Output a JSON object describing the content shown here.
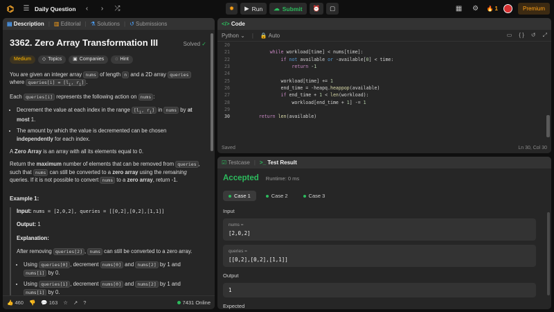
{
  "topbar": {
    "title": "Daily Question",
    "run_label": "Run",
    "submit_label": "Submit",
    "streak": "1",
    "premium_label": "Premium"
  },
  "left": {
    "tabs": [
      "Description",
      "Editorial",
      "Solutions",
      "Submissions"
    ],
    "title": "3362. Zero Array Transformation III",
    "solved": "Solved",
    "tags": [
      "Medium",
      "Topics",
      "Companies",
      "Hint"
    ],
    "footer": {
      "likes": "460",
      "comments": "163",
      "online": "7431 Online"
    }
  },
  "code": {
    "tab": "Code",
    "language": "Python",
    "mode": "Auto",
    "saved": "Saved",
    "cursor": "Ln 30, Col 30"
  },
  "result": {
    "tabs": [
      "Testcase",
      "Test Result"
    ],
    "status": "Accepted",
    "runtime": "Runtime: 0 ms",
    "cases": [
      "Case 1",
      "Case 2",
      "Case 3"
    ],
    "input_label": "Input",
    "var1_name": "nums =",
    "var1_value": "[2,0,2]",
    "var2_name": "queries =",
    "var2_value": "[[0,2],[0,2],[1,1]]",
    "output_label": "Output",
    "output_value": "1",
    "expected_label": "Expected"
  }
}
